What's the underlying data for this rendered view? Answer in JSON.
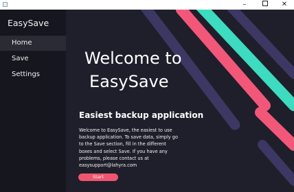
{
  "window": {
    "controls": {
      "minimize": "–",
      "close": "✕"
    }
  },
  "sidebar": {
    "title": "EasySave",
    "items": [
      {
        "label": "Home",
        "selected": true
      },
      {
        "label": "Save"
      },
      {
        "label": "Settings"
      }
    ]
  },
  "main": {
    "welcome_line1": "Welcome to",
    "welcome_line2": "EasySave",
    "subtitle": "Easiest backup application",
    "description": "Welcome to EasySave, the easiest to use backup application. To save data, simply go to the Save section, fill in the different boxes and select Save. If you have any problems, please contact us at easysupport@lahyra.com",
    "start_label": "Start"
  },
  "colors": {
    "pink": "#f2577a",
    "teal": "#3ddbc0",
    "purple": "#3d3763"
  }
}
